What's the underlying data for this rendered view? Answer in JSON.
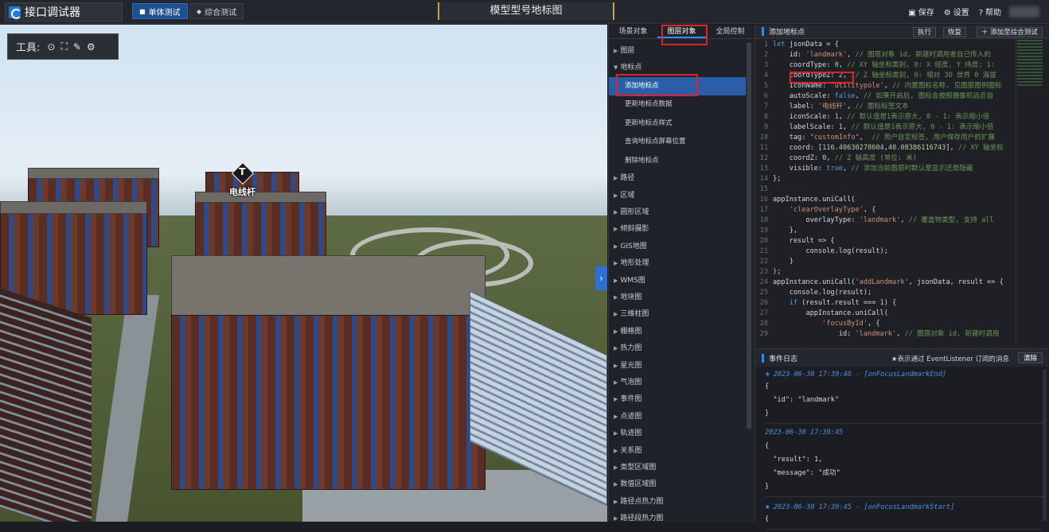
{
  "app": {
    "logo_text": "接口调试器",
    "modes": [
      "单体测试",
      "综合测试"
    ],
    "center_title": "模型型号地标图",
    "actions": {
      "save": "保存",
      "settings": "设置",
      "help": "帮助"
    }
  },
  "viewport": {
    "tools_label": "工具:",
    "marker_label": "电线杆",
    "collapse_glyph": "›"
  },
  "tree": {
    "tabs": [
      "场景对象",
      "图层对象",
      "全局控制"
    ],
    "items": [
      {
        "label": "图层",
        "type": "cat",
        "open": false
      },
      {
        "label": "地标点",
        "type": "cat",
        "open": true
      },
      {
        "label": "添加地标点",
        "type": "sub",
        "selected": true
      },
      {
        "label": "更新地标点数据",
        "type": "sub"
      },
      {
        "label": "更新地标点样式",
        "type": "sub"
      },
      {
        "label": "查询地标点屏幕位置",
        "type": "sub"
      },
      {
        "label": "删除地标点",
        "type": "sub"
      },
      {
        "label": "路径",
        "type": "cat"
      },
      {
        "label": "区域",
        "type": "cat"
      },
      {
        "label": "圆形区域",
        "type": "cat"
      },
      {
        "label": "倾斜摄影",
        "type": "cat"
      },
      {
        "label": "GIS地图",
        "type": "cat"
      },
      {
        "label": "地形处理",
        "type": "cat"
      },
      {
        "label": "WMS图",
        "type": "cat"
      },
      {
        "label": "地块图",
        "type": "cat"
      },
      {
        "label": "三维柱图",
        "type": "cat"
      },
      {
        "label": "棚格图",
        "type": "cat"
      },
      {
        "label": "热力图",
        "type": "cat"
      },
      {
        "label": "星光图",
        "type": "cat"
      },
      {
        "label": "气泡图",
        "type": "cat"
      },
      {
        "label": "事件图",
        "type": "cat"
      },
      {
        "label": "点迹图",
        "type": "cat"
      },
      {
        "label": "轨迹图",
        "type": "cat"
      },
      {
        "label": "关系图",
        "type": "cat"
      },
      {
        "label": "类型区域图",
        "type": "cat"
      },
      {
        "label": "数值区域图",
        "type": "cat"
      },
      {
        "label": "路径点热力图",
        "type": "cat"
      },
      {
        "label": "路径段热力图",
        "type": "cat"
      }
    ]
  },
  "code": {
    "title": "添加地标点",
    "buttons": {
      "run": "执行",
      "reset": "恢复",
      "add": "添加至综合测试"
    },
    "lines": [
      [
        [
          "kw",
          "let "
        ],
        [
          "t",
          "jsonData = {"
        ]
      ],
      [
        [
          "t",
          "    id: "
        ],
        [
          "s",
          "'landmark'"
        ],
        [
          "t",
          ", "
        ],
        [
          "c",
          "// 图层对象 id, 新建时调用者自己传入的"
        ]
      ],
      [
        [
          "t",
          "    coordType: "
        ],
        [
          "n",
          "0"
        ],
        [
          "t",
          ", "
        ],
        [
          "c",
          "// XY 轴坐标类别, 0: X 经度, Y 纬度; 1:"
        ]
      ],
      [
        [
          "t",
          "    coordTypeZ: "
        ],
        [
          "n",
          "2"
        ],
        [
          "t",
          ", "
        ],
        [
          "c",
          "// Z 轴坐标类别, 0: 相对 3D 世界 0 海拔"
        ]
      ],
      [
        [
          "t",
          "    iconName: "
        ],
        [
          "s",
          "'utilitypole'"
        ],
        [
          "t",
          ", "
        ],
        [
          "c",
          "// 内置图标名称, 见图层图例图标"
        ]
      ],
      [
        [
          "t",
          "    autoScale: "
        ],
        [
          "kw",
          "false"
        ],
        [
          "t",
          ", "
        ],
        [
          "c",
          "// 如果开启后, 图标会按照摄像机远近自"
        ]
      ],
      [
        [
          "t",
          "    label: "
        ],
        [
          "s",
          "'电线杆'"
        ],
        [
          "t",
          ", "
        ],
        [
          "c",
          "// 图标标签文本"
        ]
      ],
      [
        [
          "t",
          "    iconScale: "
        ],
        [
          "n",
          "1"
        ],
        [
          "t",
          ", "
        ],
        [
          "c",
          "// 默认值是1表示原大, 0 - 1: 表示缩小倍"
        ]
      ],
      [
        [
          "t",
          "    labelScale: "
        ],
        [
          "n",
          "1"
        ],
        [
          "t",
          ", "
        ],
        [
          "c",
          "// 默认值是1表示原大, 0 - 1: 表示缩小倍"
        ]
      ],
      [
        [
          "t",
          "    tag: "
        ],
        [
          "s",
          "\"customInfo\""
        ],
        [
          "t",
          ",  "
        ],
        [
          "c",
          "// 用户自定标签, 用户保存用户的扩展"
        ]
      ],
      [
        [
          "t",
          "    coord: ["
        ],
        [
          "n",
          "116.40630278604"
        ],
        [
          "t",
          ","
        ],
        [
          "n",
          "40.08386116743"
        ],
        [
          "t",
          "], "
        ],
        [
          "c",
          "// XY 轴坐标"
        ]
      ],
      [
        [
          "t",
          "    coordZ: "
        ],
        [
          "n",
          "0"
        ],
        [
          "t",
          ", "
        ],
        [
          "c",
          "// Z 轴高度 (单位: 米)"
        ]
      ],
      [
        [
          "t",
          "    visible: "
        ],
        [
          "kw",
          "true"
        ],
        [
          "t",
          ", "
        ],
        [
          "c",
          "// 添加当前图层时默认是显示还是隐藏"
        ]
      ],
      [
        [
          "t",
          "};"
        ]
      ],
      [
        [
          "t",
          ""
        ]
      ],
      [
        [
          "t",
          "appInstance.uniCall("
        ]
      ],
      [
        [
          "t",
          "    "
        ],
        [
          "s",
          "'clearOverlayType'"
        ],
        [
          "t",
          ", {"
        ]
      ],
      [
        [
          "t",
          "        overlayType: "
        ],
        [
          "s",
          "'landmark'"
        ],
        [
          "t",
          ", "
        ],
        [
          "c",
          "// 覆盖物类型, 支持 all"
        ]
      ],
      [
        [
          "t",
          "    },"
        ]
      ],
      [
        [
          "t",
          "    result => {"
        ]
      ],
      [
        [
          "t",
          "        console.log(result);"
        ]
      ],
      [
        [
          "t",
          "    }"
        ]
      ],
      [
        [
          "t",
          ");"
        ]
      ],
      [
        [
          "t",
          "appInstance.uniCall("
        ],
        [
          "s",
          "'addLandmark'"
        ],
        [
          "t",
          ", jsonData, result => {"
        ]
      ],
      [
        [
          "t",
          "    console.log(result);"
        ]
      ],
      [
        [
          "t",
          "    "
        ],
        [
          "kw",
          "if"
        ],
        [
          "t",
          " (result.result === "
        ],
        [
          "n",
          "1"
        ],
        [
          "t",
          ") {"
        ]
      ],
      [
        [
          "t",
          "        appInstance.uniCall("
        ]
      ],
      [
        [
          "t",
          "            "
        ],
        [
          "s",
          "'focusById'"
        ],
        [
          "t",
          ", {"
        ]
      ],
      [
        [
          "t",
          "                id: "
        ],
        [
          "s",
          "'landmark'"
        ],
        [
          "t",
          ", "
        ],
        [
          "c",
          "// 图层对象 id, 新建时调用"
        ]
      ]
    ]
  },
  "log": {
    "title": "事件日志",
    "note": "★表示通过 EventListener 订阅的消息",
    "clear": "清除",
    "entries": [
      {
        "star": true,
        "ts": "2023-06-30 17:39:46 - [onFocusLandmarkEnd]",
        "body": [
          "{",
          "  \"id\": \"landmark\"",
          "}"
        ]
      },
      {
        "star": false,
        "ts": "2023-06-30 17:39:45",
        "body": [
          "{",
          "  \"result\": 1,",
          "  \"message\": \"成功\"",
          "}"
        ]
      },
      {
        "star": true,
        "ts": "2023-06-30 17:39:45 - [onFocusLandmarkStart]",
        "body": [
          "{"
        ]
      }
    ]
  }
}
